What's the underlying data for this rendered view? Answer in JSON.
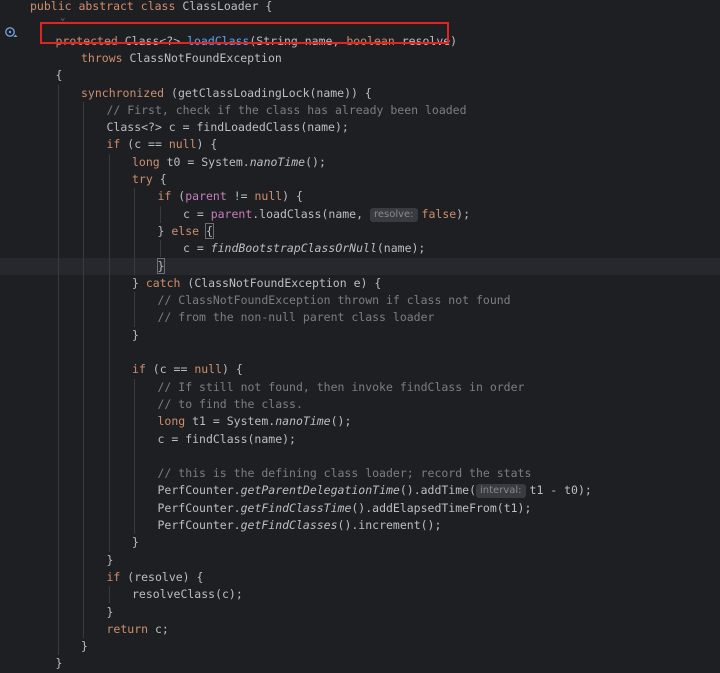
{
  "editor": {
    "lines": [
      {
        "indent": 0,
        "tokens": [
          {
            "t": "public abstract class ",
            "c": "kw"
          },
          {
            "t": "ClassLoader {",
            "c": "plain"
          }
        ]
      },
      {
        "indent": 0,
        "tokens": []
      },
      {
        "indent": 1,
        "tokens": [
          {
            "t": "protected ",
            "c": "kw"
          },
          {
            "t": "Class<?> ",
            "c": "plain"
          },
          {
            "t": "loadClass",
            "c": "fn"
          },
          {
            "t": "(String name, ",
            "c": "plain"
          },
          {
            "t": "boolean ",
            "c": "kw"
          },
          {
            "t": "resolve)",
            "c": "plain"
          }
        ]
      },
      {
        "indent": 2,
        "tokens": [
          {
            "t": "throws ",
            "c": "kw"
          },
          {
            "t": "ClassNotFoundException",
            "c": "plain"
          }
        ]
      },
      {
        "indent": 1,
        "tokens": [
          {
            "t": "{",
            "c": "plain"
          }
        ]
      },
      {
        "indent": 2,
        "tokens": [
          {
            "t": "synchronized ",
            "c": "kw"
          },
          {
            "t": "(getClassLoadingLock(name)) {",
            "c": "plain"
          }
        ]
      },
      {
        "indent": 3,
        "tokens": [
          {
            "t": "// First, check if the class has already been loaded",
            "c": "cmt"
          }
        ]
      },
      {
        "indent": 3,
        "tokens": [
          {
            "t": "Class<?> c = findLoadedClass(name);",
            "c": "plain"
          }
        ]
      },
      {
        "indent": 3,
        "tokens": [
          {
            "t": "if ",
            "c": "kw"
          },
          {
            "t": "(c == ",
            "c": "plain"
          },
          {
            "t": "null",
            "c": "kw"
          },
          {
            "t": ") {",
            "c": "plain"
          }
        ]
      },
      {
        "indent": 4,
        "tokens": [
          {
            "t": "long ",
            "c": "kw"
          },
          {
            "t": "t0 = System.",
            "c": "plain"
          },
          {
            "t": "nanoTime",
            "c": "it"
          },
          {
            "t": "();",
            "c": "plain"
          }
        ]
      },
      {
        "indent": 4,
        "tokens": [
          {
            "t": "try ",
            "c": "kw"
          },
          {
            "t": "{",
            "c": "plain"
          }
        ]
      },
      {
        "indent": 5,
        "tokens": [
          {
            "t": "if ",
            "c": "kw"
          },
          {
            "t": "(",
            "c": "plain"
          },
          {
            "t": "parent",
            "c": "fld"
          },
          {
            "t": " != ",
            "c": "plain"
          },
          {
            "t": "null",
            "c": "kw"
          },
          {
            "t": ") {",
            "c": "plain"
          }
        ]
      },
      {
        "indent": 6,
        "tokens": [
          {
            "t": "c = ",
            "c": "plain"
          },
          {
            "t": "parent",
            "c": "fld"
          },
          {
            "t": ".loadClass(name, ",
            "c": "plain"
          },
          {
            "hint": "resolve:"
          },
          {
            "t": "false",
            "c": "kw"
          },
          {
            "t": ");",
            "c": "plain"
          }
        ]
      },
      {
        "indent": 5,
        "tokens": [
          {
            "t": "} ",
            "c": "plain"
          },
          {
            "t": "else ",
            "c": "kw"
          },
          {
            "t": "{",
            "c": "brace"
          }
        ]
      },
      {
        "indent": 6,
        "tokens": [
          {
            "t": "c = ",
            "c": "plain"
          },
          {
            "t": "findBootstrapClassOrNull",
            "c": "it"
          },
          {
            "t": "(name);",
            "c": "plain"
          }
        ]
      },
      {
        "indent": 5,
        "tokens": [
          {
            "t": "}",
            "c": "brace"
          }
        ],
        "current": true
      },
      {
        "indent": 4,
        "tokens": [
          {
            "t": "} ",
            "c": "plain"
          },
          {
            "t": "catch ",
            "c": "kw"
          },
          {
            "t": "(ClassNotFoundException e) {",
            "c": "plain"
          }
        ]
      },
      {
        "indent": 5,
        "tokens": [
          {
            "t": "// ClassNotFoundException thrown if class not found",
            "c": "cmt"
          }
        ]
      },
      {
        "indent": 5,
        "tokens": [
          {
            "t": "// from the non-null parent class loader",
            "c": "cmt"
          }
        ]
      },
      {
        "indent": 4,
        "tokens": [
          {
            "t": "}",
            "c": "plain"
          }
        ]
      },
      {
        "indent": 0,
        "tokens": []
      },
      {
        "indent": 4,
        "tokens": [
          {
            "t": "if ",
            "c": "kw"
          },
          {
            "t": "(c == ",
            "c": "plain"
          },
          {
            "t": "null",
            "c": "kw"
          },
          {
            "t": ") {",
            "c": "plain"
          }
        ]
      },
      {
        "indent": 5,
        "tokens": [
          {
            "t": "// If still not found, then invoke findClass in order",
            "c": "cmt"
          }
        ]
      },
      {
        "indent": 5,
        "tokens": [
          {
            "t": "// to find the class.",
            "c": "cmt"
          }
        ]
      },
      {
        "indent": 5,
        "tokens": [
          {
            "t": "long ",
            "c": "kw"
          },
          {
            "t": "t1 = System.",
            "c": "plain"
          },
          {
            "t": "nanoTime",
            "c": "it"
          },
          {
            "t": "();",
            "c": "plain"
          }
        ]
      },
      {
        "indent": 5,
        "tokens": [
          {
            "t": "c = findClass(name);",
            "c": "plain"
          }
        ]
      },
      {
        "indent": 0,
        "tokens": []
      },
      {
        "indent": 5,
        "tokens": [
          {
            "t": "// this is the defining class loader; record the stats",
            "c": "cmt"
          }
        ]
      },
      {
        "indent": 5,
        "tokens": [
          {
            "t": "PerfCounter.",
            "c": "plain"
          },
          {
            "t": "getParentDelegationTime",
            "c": "it"
          },
          {
            "t": "().addTime(",
            "c": "plain"
          },
          {
            "hint": "interval:"
          },
          {
            "t": "t1 - t0);",
            "c": "plain"
          }
        ]
      },
      {
        "indent": 5,
        "tokens": [
          {
            "t": "PerfCounter.",
            "c": "plain"
          },
          {
            "t": "getFindClassTime",
            "c": "it"
          },
          {
            "t": "().addElapsedTimeFrom(t1);",
            "c": "plain"
          }
        ]
      },
      {
        "indent": 5,
        "tokens": [
          {
            "t": "PerfCounter.",
            "c": "plain"
          },
          {
            "t": "getFindClasses",
            "c": "it"
          },
          {
            "t": "().increment();",
            "c": "plain"
          }
        ]
      },
      {
        "indent": 4,
        "tokens": [
          {
            "t": "}",
            "c": "plain"
          }
        ]
      },
      {
        "indent": 3,
        "tokens": [
          {
            "t": "}",
            "c": "plain"
          }
        ]
      },
      {
        "indent": 3,
        "tokens": [
          {
            "t": "if ",
            "c": "kw"
          },
          {
            "t": "(resolve) {",
            "c": "plain"
          }
        ]
      },
      {
        "indent": 4,
        "tokens": [
          {
            "t": "resolveClass(c);",
            "c": "plain"
          }
        ]
      },
      {
        "indent": 3,
        "tokens": [
          {
            "t": "}",
            "c": "plain"
          }
        ]
      },
      {
        "indent": 3,
        "tokens": [
          {
            "t": "return ",
            "c": "kw"
          },
          {
            "t": "c;",
            "c": "plain"
          }
        ]
      },
      {
        "indent": 2,
        "tokens": [
          {
            "t": "}",
            "c": "plain"
          }
        ]
      },
      {
        "indent": 1,
        "tokens": [
          {
            "t": "}",
            "c": "plain"
          }
        ]
      }
    ]
  },
  "colors": {
    "background": "#1e1f22",
    "keyword": "#cf8e6d",
    "comment": "#7a7e85",
    "method_declaration": "#56a8f5",
    "field": "#c77dbb",
    "default_text": "#bcbec4",
    "highlight_box": "#e02424"
  },
  "gutter": {
    "icon": "override-method-icon"
  }
}
